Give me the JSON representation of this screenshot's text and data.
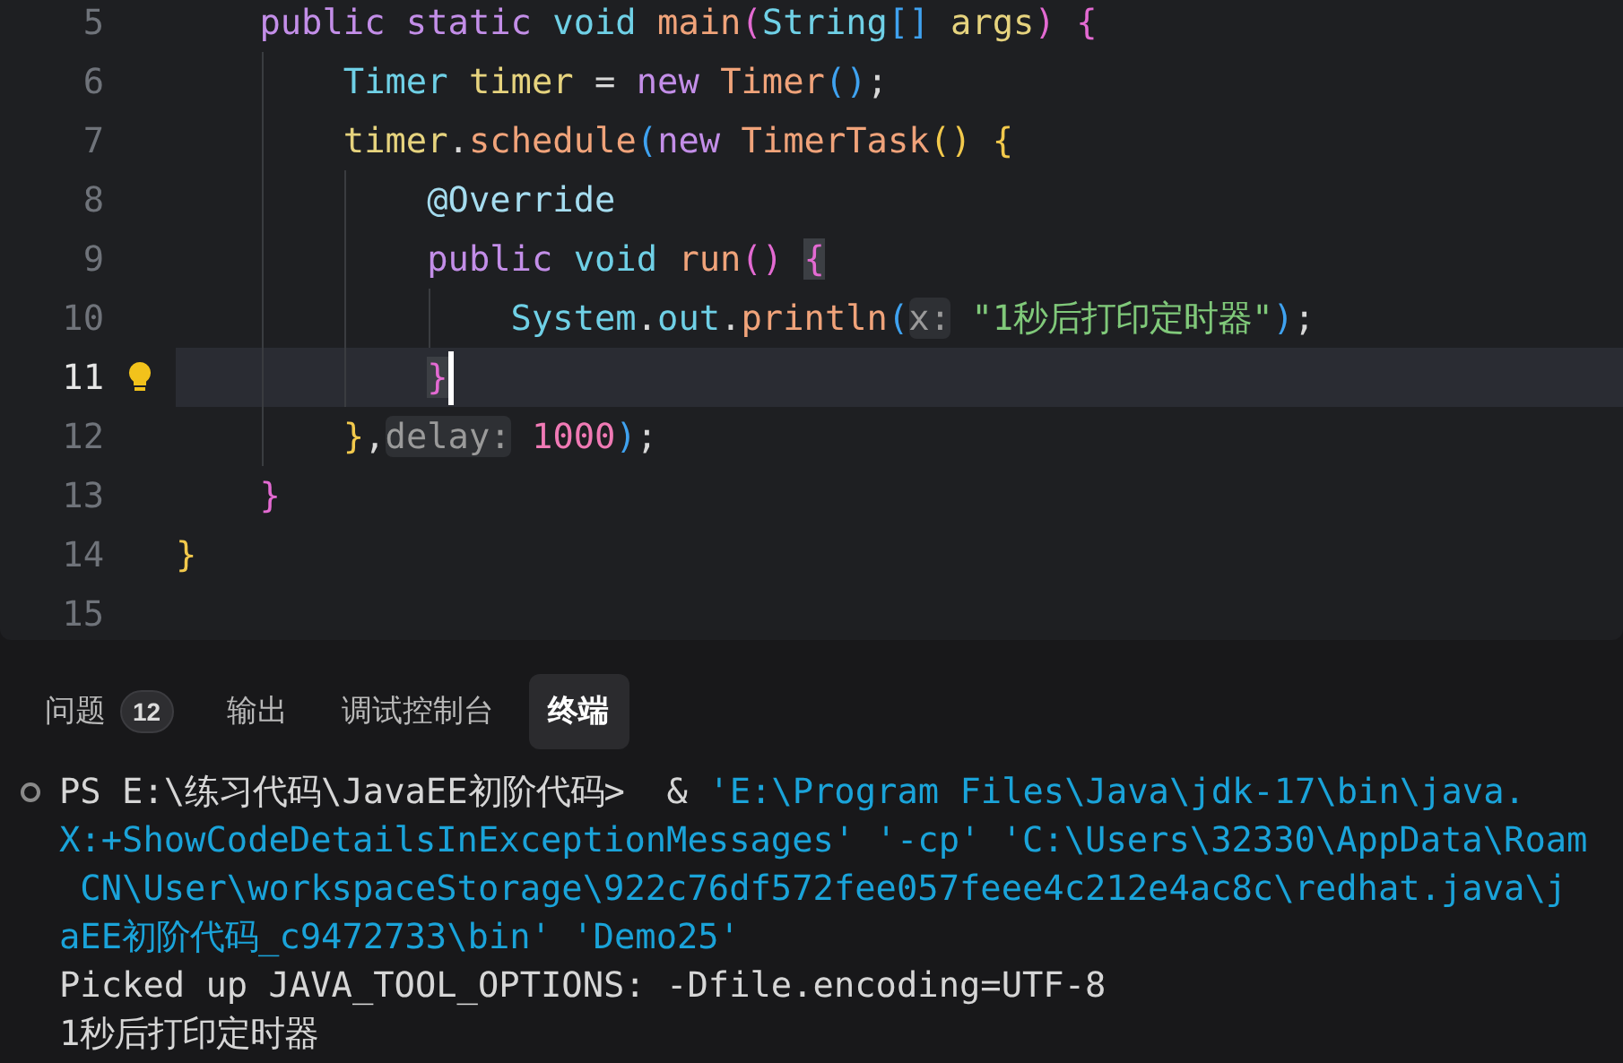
{
  "editor": {
    "lines": [
      {
        "number": "5",
        "current": false,
        "tokens": [
          {
            "text": "    public static ",
            "kind": "kw"
          },
          {
            "text": "void ",
            "kind": "type"
          },
          {
            "text": "main",
            "kind": "fn"
          },
          {
            "text": "(",
            "kind": "p2"
          },
          {
            "text": "String",
            "kind": "type"
          },
          {
            "text": "[]",
            "kind": "p3"
          },
          {
            "text": " args",
            "kind": "var"
          },
          {
            "text": ") {",
            "kind": "p2"
          }
        ]
      },
      {
        "number": "6",
        "current": false,
        "tokens": [
          {
            "text": "        Timer ",
            "kind": "type"
          },
          {
            "text": "timer",
            "kind": "var"
          },
          {
            "text": " = ",
            "kind": "plain"
          },
          {
            "text": "new ",
            "kind": "kw"
          },
          {
            "text": "Timer",
            "kind": "fn"
          },
          {
            "text": "()",
            "kind": "p3"
          },
          {
            "text": ";",
            "kind": "plain"
          }
        ]
      },
      {
        "number": "7",
        "current": false,
        "tokens": [
          {
            "text": "        timer",
            "kind": "var"
          },
          {
            "text": ".",
            "kind": "plain"
          },
          {
            "text": "schedule",
            "kind": "fn"
          },
          {
            "text": "(",
            "kind": "p3"
          },
          {
            "text": "new ",
            "kind": "kw"
          },
          {
            "text": "TimerTask",
            "kind": "fn"
          },
          {
            "text": "() {",
            "kind": "p1"
          }
        ]
      },
      {
        "number": "8",
        "current": false,
        "tokens": [
          {
            "text": "            @Override",
            "kind": "annot"
          }
        ]
      },
      {
        "number": "9",
        "current": false,
        "tokens": [
          {
            "text": "            public ",
            "kind": "kw"
          },
          {
            "text": "void ",
            "kind": "type"
          },
          {
            "text": "run",
            "kind": "fn"
          },
          {
            "text": "() ",
            "kind": "p2"
          },
          {
            "text": "{",
            "kind": "match"
          }
        ]
      },
      {
        "number": "10",
        "current": false,
        "tokens": [
          {
            "text": "                System",
            "kind": "type"
          },
          {
            "text": ".",
            "kind": "plain"
          },
          {
            "text": "out",
            "kind": "type"
          },
          {
            "text": ".",
            "kind": "plain"
          },
          {
            "text": "println",
            "kind": "fn"
          },
          {
            "text": "(",
            "kind": "p3"
          },
          {
            "text": "x:",
            "kind": "hint"
          },
          {
            "text": " \"1秒后打印定时器\"",
            "kind": "str"
          },
          {
            "text": ")",
            "kind": "p3"
          },
          {
            "text": ";",
            "kind": "plain"
          }
        ]
      },
      {
        "number": "11",
        "current": true,
        "tokens": [
          {
            "text": "            }",
            "kind": "match"
          }
        ]
      },
      {
        "number": "12",
        "current": false,
        "tokens": [
          {
            "text": "        }",
            "kind": "p1"
          },
          {
            "text": ",",
            "kind": "plain"
          },
          {
            "text": "delay:",
            "kind": "hint"
          },
          {
            "text": " 1000",
            "kind": "num"
          },
          {
            "text": ")",
            "kind": "p3"
          },
          {
            "text": ";",
            "kind": "plain"
          }
        ]
      },
      {
        "number": "13",
        "current": false,
        "tokens": [
          {
            "text": "    }",
            "kind": "p2"
          }
        ]
      },
      {
        "number": "14",
        "current": false,
        "tokens": [
          {
            "text": "}",
            "kind": "p1"
          }
        ]
      },
      {
        "number": "15",
        "current": false
      }
    ]
  },
  "panel": {
    "tabs": [
      {
        "label": "问题",
        "badge": "12",
        "selected": false
      },
      {
        "label": "输出",
        "selected": false
      },
      {
        "label": "调试控制台",
        "selected": false
      },
      {
        "label": "终端",
        "selected": true
      }
    ]
  },
  "terminal": {
    "lines": [
      {
        "prompt": true,
        "segments": [
          {
            "text": "PS E:\\练习代码\\JavaEE初阶代码>  & ",
            "kind": "plain"
          },
          {
            "text": "'E:\\Program Files\\Java\\jdk-17\\bin\\java.",
            "kind": "path"
          }
        ]
      },
      {
        "prompt": false,
        "segments": [
          {
            "text": "X:+ShowCodeDetailsInExceptionMessages' '-cp' 'C:\\Users\\32330\\AppData\\Roam",
            "kind": "path"
          }
        ]
      },
      {
        "prompt": false,
        "segments": [
          {
            "text": " CN\\User\\workspaceStorage\\922c76df572fee057feee4c212e4ac8c\\redhat.java\\j",
            "kind": "path"
          }
        ]
      },
      {
        "prompt": false,
        "segments": [
          {
            "text": "aEE初阶代码_c9472733\\bin' 'Demo25'",
            "kind": "path"
          }
        ]
      },
      {
        "prompt": false,
        "segments": [
          {
            "text": "Picked up JAVA_TOOL_OPTIONS: -Dfile.encoding=UTF-8",
            "kind": "plain"
          }
        ]
      },
      {
        "prompt": false,
        "segments": [
          {
            "text": "1秒后打印定时器",
            "kind": "plain"
          }
        ]
      }
    ]
  }
}
